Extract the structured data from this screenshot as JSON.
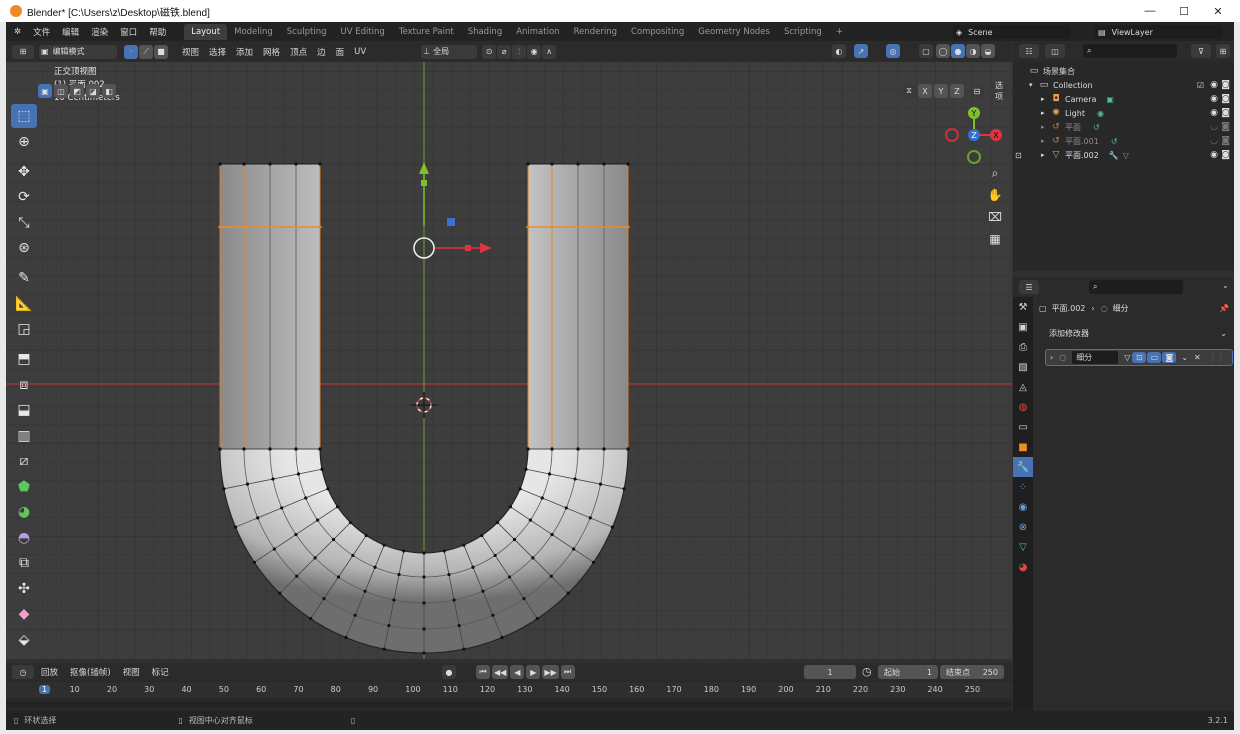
{
  "window": {
    "title": "Blender* [C:\\Users\\z\\Desktop\\磁铁.blend]",
    "controls": {
      "minimize": "—",
      "maximize": "☐",
      "close": "✕"
    }
  },
  "menu": [
    "文件",
    "编辑",
    "渲染",
    "窗口",
    "帮助"
  ],
  "workspaces": [
    {
      "label": "Layout",
      "active": true
    },
    {
      "label": "Modeling",
      "active": false
    },
    {
      "label": "Sculpting",
      "active": false
    },
    {
      "label": "UV Editing",
      "active": false
    },
    {
      "label": "Texture Paint",
      "active": false
    },
    {
      "label": "Shading",
      "active": false
    },
    {
      "label": "Animation",
      "active": false
    },
    {
      "label": "Rendering",
      "active": false
    },
    {
      "label": "Compositing",
      "active": false
    },
    {
      "label": "Geometry Nodes",
      "active": false
    },
    {
      "label": "Scripting",
      "active": false
    }
  ],
  "add_workspace": "+",
  "scene": {
    "name": "Scene",
    "view_layer": "ViewLayer"
  },
  "viewport_header": {
    "mode": "编辑模式",
    "menus": [
      "视图",
      "选择",
      "添加",
      "网格",
      "顶点",
      "边",
      "面",
      "UV"
    ],
    "transform": "全局",
    "options": "选项",
    "axes": [
      "X",
      "Y",
      "Z"
    ]
  },
  "viewport_info": {
    "view": "正交顶视图",
    "object": "(1) 平面.002",
    "scale": "10 Centimeters"
  },
  "gizmo_axes": {
    "x": "X",
    "y": "Y",
    "z": "Z"
  },
  "colors": {
    "accent": "#4772b3",
    "x_axis": "#c8343d",
    "y_axis": "#6aa02b",
    "selection": "#f08a24",
    "mesh": "#c9c9c9"
  },
  "outliner": {
    "title": "场景集合",
    "items": [
      {
        "name": "Collection",
        "icon": "collection-icon",
        "depth": 1
      },
      {
        "name": "Camera",
        "icon": "camera-icon",
        "depth": 2
      },
      {
        "name": "Light",
        "icon": "light-icon",
        "depth": 2
      },
      {
        "name": "平面",
        "icon": "curve-icon",
        "depth": 2,
        "dim": true
      },
      {
        "name": "平面.001",
        "icon": "curve-icon",
        "depth": 2,
        "dim": true
      },
      {
        "name": "平面.002",
        "icon": "mesh-icon",
        "depth": 2,
        "dim": false
      }
    ]
  },
  "properties": {
    "object": "平面.002",
    "modifier_tab": "细分",
    "add_modifier": "添加修改器",
    "modifier_name": "细分"
  },
  "timeline": {
    "menus": [
      "回放",
      "抠像(插帧)",
      "视图",
      "标记"
    ],
    "current_frame": "1",
    "start_label": "起始",
    "start": "1",
    "end_label": "结束点",
    "end": "250",
    "ticks": [
      "1",
      "10",
      "20",
      "30",
      "40",
      "50",
      "60",
      "70",
      "80",
      "90",
      "100",
      "110",
      "120",
      "130",
      "140",
      "150",
      "160",
      "170",
      "180",
      "190",
      "200",
      "210",
      "220",
      "230",
      "240",
      "250"
    ]
  },
  "status": {
    "left": "环状选择",
    "middle": "视图中心对齐鼠标",
    "version": "3.2.1"
  }
}
